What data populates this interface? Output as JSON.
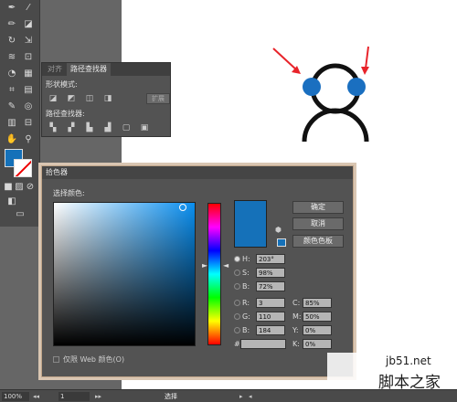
{
  "colors": {
    "selected": "#1571b9",
    "accent": "#1a6fc0",
    "arrow": "#e8232a"
  },
  "toolbar": {
    "icons": [
      "pen-icon",
      "brush-icon",
      "pencil-icon",
      "eraser-icon",
      "rotate-icon",
      "scale-icon",
      "warp-icon",
      "free-transform-icon",
      "shape-builder-icon",
      "perspective-icon",
      "mesh-icon",
      "gradient-icon",
      "eyedropper-icon",
      "blend-icon",
      "symbol-sprayer-icon",
      "column-graph-icon",
      "artboard-icon",
      "slice-icon",
      "hand-icon",
      "zoom-icon"
    ]
  },
  "pathfinder": {
    "tab_align": "对齐",
    "tab_pathfinder": "路径查找器",
    "shape_modes_label": "形状模式:",
    "pathfinders_label": "路径查找器:",
    "expand_label": "扩展"
  },
  "picker": {
    "title": "拾色器",
    "select_label": "选择颜色:",
    "ok": "确定",
    "cancel": "取消",
    "swatches": "颜色色板",
    "h_label": "H:",
    "h_value": "203°",
    "s_label": "S:",
    "s_value": "98%",
    "b_label": "B:",
    "b_value": "72%",
    "r_label": "R:",
    "r_value": "3",
    "g_label": "G:",
    "g_value": "110",
    "bl_label": "B:",
    "bl_value": "184",
    "c_label": "C:",
    "c_value": "85%",
    "m_label": "M:",
    "m_value": "50%",
    "y_label": "Y:",
    "y_value": "0%",
    "k_label": "K:",
    "k_value": "0%",
    "hex_label": "#",
    "hex_value": "",
    "web_only": "仅限 Web 颜色(O)"
  },
  "statusbar": {
    "zoom": "100%",
    "artboard": "1",
    "tool": "选择"
  },
  "watermark": {
    "top": "jb51.net",
    "bottom": "脚本之家"
  }
}
